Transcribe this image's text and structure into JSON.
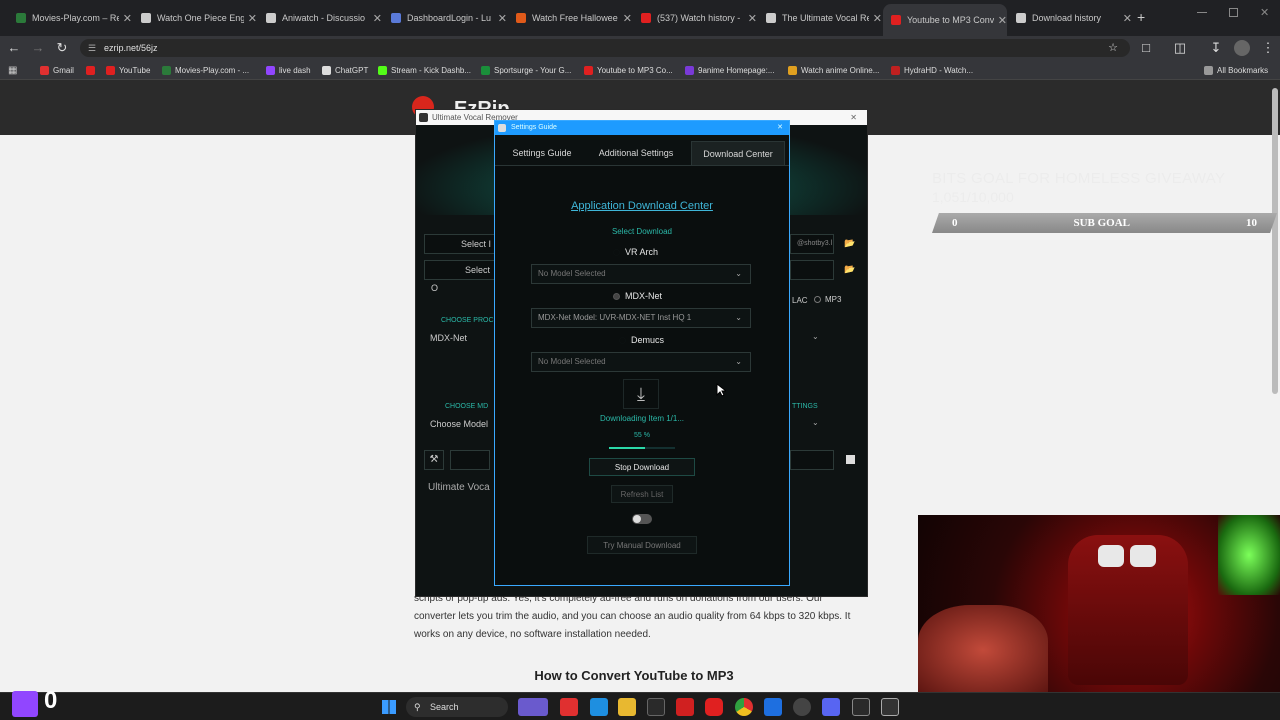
{
  "browser": {
    "tabs": [
      {
        "title": "Movies-Play.com – Re",
        "color": "#2b7a3a"
      },
      {
        "title": "Watch One Piece Eng",
        "color": "#cccccc"
      },
      {
        "title": "Aniwatch - Discussio",
        "color": "#cccccc"
      },
      {
        "title": "DashboardLogin - Lu",
        "color": "#5a7ad8"
      },
      {
        "title": "Watch Free Hallowee",
        "color": "#e05a1a"
      },
      {
        "title": "(537) Watch history -",
        "color": "#e02020"
      },
      {
        "title": "The Ultimate Vocal Re",
        "color": "#cccccc"
      },
      {
        "title": "Youtube to MP3 Conv",
        "color": "#e02020"
      },
      {
        "title": "Download history",
        "color": "#cccccc"
      }
    ],
    "close_glyph": "✕",
    "new_tab_glyph": "+",
    "url": "ezrip.net/56jz",
    "bookmarks": [
      {
        "label": "Gmail",
        "color": "#e03030"
      },
      {
        "label": "",
        "color": "#e02020"
      },
      {
        "label": "YouTube",
        "color": "#e02020"
      },
      {
        "label": "Movies-Play.com - ...",
        "color": "#2b7a3a"
      },
      {
        "label": "live dash",
        "color": "#9146ff"
      },
      {
        "label": "ChatGPT",
        "color": "#dddddd"
      },
      {
        "label": "Stream - Kick Dashb...",
        "color": "#53fc18"
      },
      {
        "label": "Sportsurge - Your G...",
        "color": "#1a8f3a"
      },
      {
        "label": "Youtube to MP3 Co...",
        "color": "#e02020"
      },
      {
        "label": "9anime Homepage:...",
        "color": "#7a3ad8"
      },
      {
        "label": "Watch anime Online...",
        "color": "#e0a020"
      },
      {
        "label": "HydraHD - Watch...",
        "color": "#c02020"
      }
    ],
    "all_bookmarks": "All Bookmarks"
  },
  "site": {
    "logo_text": "EzRip",
    "body_text": "scripts or pop-up ads. Yes, it's completely ad-free and runs on donations from our users. Our converter lets you trim the audio, and you can choose an audio quality from 64 kbps to 320 kbps. It works on any device, no software installation needed.",
    "heading": "How to Convert YouTube to MP3"
  },
  "overlay": {
    "bits_title": "BITS GOAL FOR HOMELESS GIVEAWAY",
    "bits_count": "1,051/10,000",
    "sub_left": "0",
    "sub_label": "SUB GOAL",
    "sub_right": "10",
    "twitch_count": "0"
  },
  "uvr": {
    "title": "Ultimate Vocal Remover",
    "select_input": "Select I",
    "select_output": "Select O",
    "output_hint": "@shotby3.l",
    "choose_process": "CHOOSE PROC",
    "process_value": "MDX-Net",
    "choose_model": "CHOOSE MD",
    "model_value": "Choose Model",
    "settings_label": "TTINGS",
    "flac": "LAC",
    "mp3": "MP3",
    "console_text": "Ultimate Voca"
  },
  "dialog": {
    "title": "Settings Guide",
    "tabs": [
      "Settings Guide",
      "Additional Settings",
      "Download Center"
    ],
    "heading": "Application Download Center",
    "select_download": "Select Download",
    "vr_arch": "VR Arch",
    "vr_model": "No Model Selected",
    "mdx_net": "MDX-Net",
    "mdx_model": "MDX-Net Model: UVR-MDX-NET Inst HQ 1",
    "demucs": "Demucs",
    "demucs_model": "No Model Selected",
    "downloading": "Downloading Item 1/1...",
    "progress_label": "55 %",
    "progress": 0.55,
    "stop": "Stop Download",
    "refresh": "Refresh List",
    "manual": "Try Manual Download"
  },
  "taskbar": {
    "search": "Search"
  },
  "colors": {
    "accent": "#2bb8a8",
    "dialog_border": "#3aa9ff"
  }
}
